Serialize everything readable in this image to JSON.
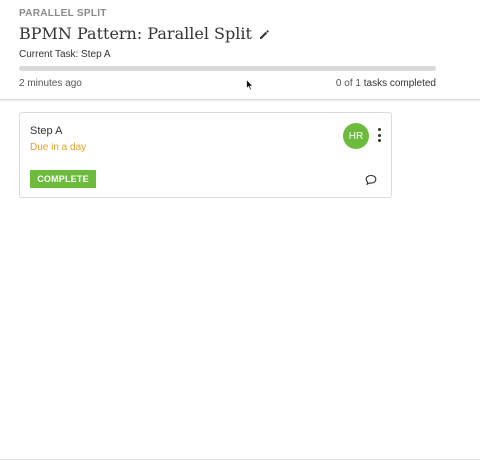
{
  "header": {
    "eyebrow": "PARALLEL SPLIT",
    "title": "BPMN Pattern: Parallel Split",
    "current_task": "Current Task: Step A",
    "time_ago": "2 minutes ago",
    "tasks_count": "0 of 1",
    "tasks_suffix": "tasks completed",
    "progress_fraction": 0
  },
  "task_card": {
    "title": "Step A",
    "due": "Due in a day",
    "avatar_initials": "HR",
    "complete_label": "COMPLETE"
  },
  "icons": {
    "edit": "pencil-icon",
    "menu": "more-vertical-icon",
    "comment": "comment-icon",
    "cursor": "mouse-pointer-icon"
  },
  "colors": {
    "accent_green": "#6cbb3c",
    "due_orange": "#e0a128",
    "progress_track": "#d9d9d9"
  }
}
